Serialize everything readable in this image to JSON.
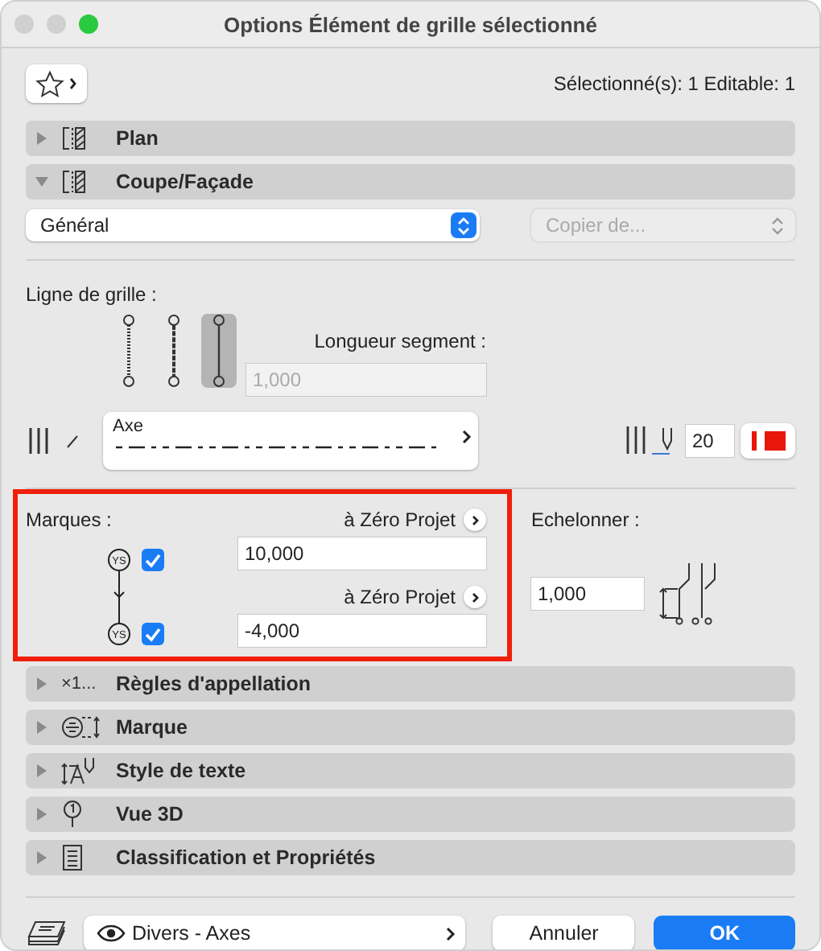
{
  "window": {
    "title": "Options Élément de grille sélectionné"
  },
  "selection_info": "Sélectionné(s): 1 Editable: 1",
  "top_sections": [
    {
      "label": "Plan",
      "expanded": false
    },
    {
      "label": "Coupe/Façade",
      "expanded": true
    }
  ],
  "general_select": {
    "value": "Général"
  },
  "copy_select": {
    "value": "Copier de...",
    "disabled": true
  },
  "grid_line": {
    "label": "Ligne de grille :",
    "line_types": [
      {
        "kind": "dotted",
        "selected": false
      },
      {
        "kind": "dashed",
        "selected": false
      },
      {
        "kind": "solid",
        "selected": true
      }
    ],
    "segment_label": "Longueur segment :",
    "segment_value": "1,000",
    "segment_disabled": true,
    "line_name": "Axe",
    "pen": {
      "value": "20",
      "color": "#e8160c"
    }
  },
  "markers": {
    "label": "Marques :",
    "items": [
      {
        "tag": "YS",
        "checked": true,
        "anchor": "à Zéro Projet",
        "value": "10,000"
      },
      {
        "tag": "YS",
        "checked": true,
        "anchor": "à Zéro Projet",
        "value": "-4,000"
      }
    ]
  },
  "stagger": {
    "label": "Echelonner :",
    "value": "1,000"
  },
  "bottom_sections": [
    {
      "icon_text": "×1...",
      "label": "Règles d'appellation",
      "expanded": false
    },
    {
      "kind": "marker",
      "label": "Marque",
      "expanded": false
    },
    {
      "kind": "text",
      "label": "Style de texte",
      "expanded": false
    },
    {
      "kind": "view3d",
      "label": "Vue 3D",
      "expanded": false
    },
    {
      "kind": "classification",
      "label": "Classification et Propriétés",
      "expanded": false
    }
  ],
  "footer": {
    "layer": "Divers - Axes",
    "buttons": [
      {
        "label": "Annuler",
        "kind": "secondary"
      },
      {
        "label": "OK",
        "kind": "primary"
      }
    ]
  }
}
